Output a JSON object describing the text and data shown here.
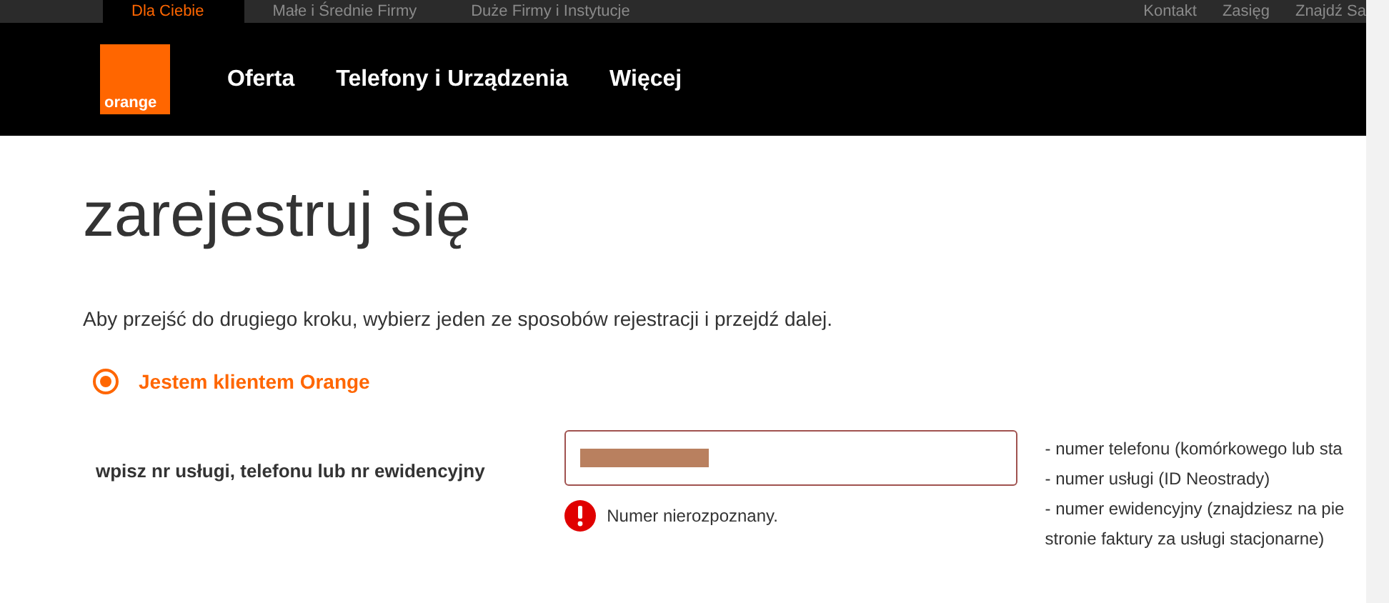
{
  "top_nav": [
    {
      "label": "Dla Ciebie",
      "selected": true
    },
    {
      "label": "Małe i Średnie Firmy",
      "selected": false
    },
    {
      "label": "Duże Firmy i Instytucje",
      "selected": false
    }
  ],
  "top_links": [
    "Kontakt",
    "Zasięg",
    "Znajdź Sa"
  ],
  "logo": {
    "text": "orange"
  },
  "main_nav": [
    "Oferta",
    "Telefony i Urządzenia",
    "Więcej"
  ],
  "title": "zarejestruj się",
  "intro": "Aby przejść do drugiego kroku, wybierz jeden ze sposobów rejestracji i przejdź dalej.",
  "options": [
    {
      "label": "Jestem klientem Orange",
      "selected": true
    }
  ],
  "field": {
    "label": "wpisz nr usługi, telefonu lub nr ewidencyjny",
    "error": "Numer nierozpoznany.",
    "invalid": true
  },
  "help": [
    "- numer telefonu (komórkowego lub sta",
    "- numer usługi (ID Neostrady)",
    "- numer ewidencyjny (znajdziesz na pie",
    "stronie faktury za usługi stacjonarne)"
  ]
}
